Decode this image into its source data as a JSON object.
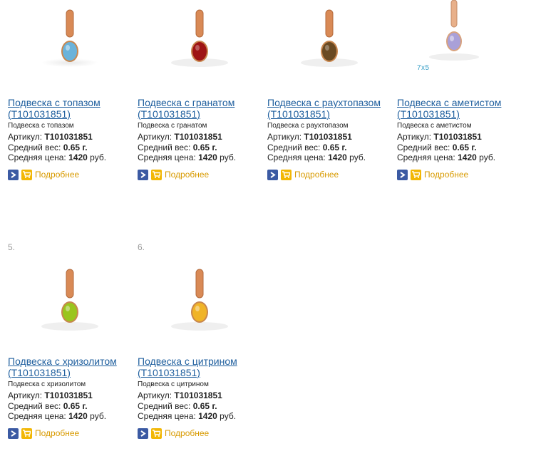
{
  "products": [
    {
      "index": "",
      "title": "Подвеска с топазом (T101031851)",
      "subtitle": "Подвеска с топазом",
      "article_label": "Артикул:",
      "article": "T101031851",
      "weight_label": "Средний вес:",
      "weight": "0.65 г.",
      "price_label": "Средняя цена:",
      "price": "1420",
      "currency": "руб.",
      "more": "Подробнее",
      "stone_color": "#6bb3da"
    },
    {
      "index": "",
      "title": "Подвеска с гранатом (T101031851)",
      "subtitle": "Подвеска с гранатом",
      "article_label": "Артикул:",
      "article": "T101031851",
      "weight_label": "Средний вес:",
      "weight": "0.65 г.",
      "price_label": "Средняя цена:",
      "price": "1420",
      "currency": "руб.",
      "more": "Подробнее",
      "stone_color": "#9e1414"
    },
    {
      "index": "",
      "title": "Подвеска с раухтопазом (T101031851)",
      "subtitle": "Подвеска с раухтопазом",
      "article_label": "Артикул:",
      "article": "T101031851",
      "weight_label": "Средний вес:",
      "weight": "0.65 г.",
      "price_label": "Средняя цена:",
      "price": "1420",
      "currency": "руб.",
      "more": "Подробнее",
      "stone_color": "#6a4a23"
    },
    {
      "index": "",
      "title": "Подвеска с аметистом (T101031851)",
      "subtitle": "Подвеска с аметистом",
      "article_label": "Артикул:",
      "article": "T101031851",
      "weight_label": "Средний вес:",
      "weight": "0.65 г.",
      "price_label": "Средняя цена:",
      "price": "1420",
      "currency": "руб.",
      "more": "Подробнее",
      "stone_color": "#a9a0d8",
      "size_note": "7x5"
    },
    {
      "index": "5.",
      "title": "Подвеска с хризолитом (T101031851)",
      "subtitle": "Подвеска с хризолитом",
      "article_label": "Артикул:",
      "article": "T101031851",
      "weight_label": "Средний вес:",
      "weight": "0.65 г.",
      "price_label": "Средняя цена:",
      "price": "1420",
      "currency": "руб.",
      "more": "Подробнее",
      "stone_color": "#9ac51e"
    },
    {
      "index": "6.",
      "title": "Подвеска с цитрином (T101031851)",
      "subtitle": "Подвеска с цитрином",
      "article_label": "Артикул:",
      "article": "T101031851",
      "weight_label": "Средний вес:",
      "weight": "0.65 г.",
      "price_label": "Средняя цена:",
      "price": "1420",
      "currency": "руб.",
      "more": "Подробнее",
      "stone_color": "#f0b428"
    }
  ],
  "colors": {
    "link": "#1f5f9e",
    "more": "#d89a00",
    "go_button": "#3b5aa3",
    "cart_button": "#f2b705",
    "gold": "#d98a56"
  }
}
